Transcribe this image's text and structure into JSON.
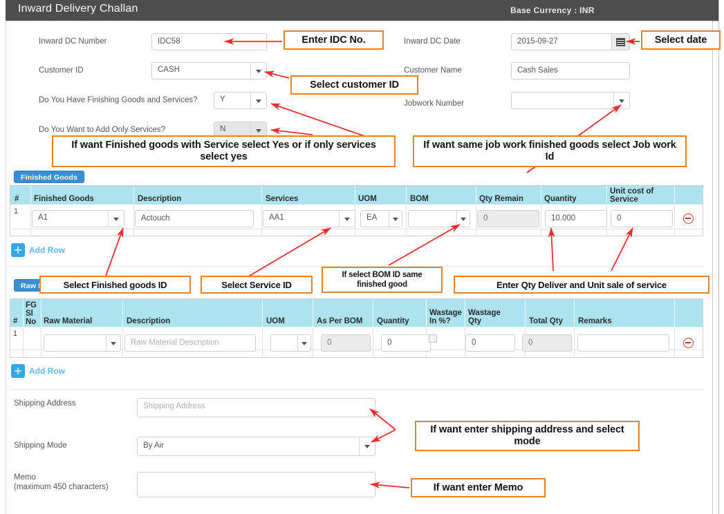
{
  "window": {
    "title": "Inward Delivery Challan",
    "base_currency": "Base Currency : INR"
  },
  "form": {
    "inward_dc_number": {
      "label": "Inward DC Number",
      "value": "IDC58"
    },
    "inward_dc_date": {
      "label": "Inward DC Date",
      "value": "2015-09-27",
      "icon": "calendar-icon"
    },
    "customer_id": {
      "label": "Customer ID",
      "value": "CASH"
    },
    "customer_name": {
      "label": "Customer Name",
      "value": "Cash Sales"
    },
    "has_finishing_goods_and_services": {
      "label": "Do You Have Finishing Goods and Services?",
      "value": "Y"
    },
    "jobwork_number": {
      "label": "Jobwork Number",
      "value": ""
    },
    "add_only_services": {
      "label": "Do You Want to Add Only Services?",
      "value": "N"
    },
    "shipping_address": {
      "label": "Shipping Address",
      "value": "",
      "placeholder": "Shipping Address"
    },
    "shipping_mode": {
      "label": "Shipping Mode",
      "value": "By Air"
    },
    "memo": {
      "label": "Memo",
      "sublabel": "(maximum 450 characters)",
      "value": ""
    }
  },
  "finished_goods": {
    "tab_label": "Finished Goods",
    "columns": [
      "#",
      "Finished Goods",
      "Description",
      "Services",
      "UOM",
      "BOM",
      "Qty Remain",
      "Quantity",
      "Unit cost of\nService",
      ""
    ],
    "rows": [
      {
        "num": "1",
        "finished_goods": "A1",
        "description": "Actouch",
        "services": "AA1",
        "uom": "EA",
        "bom": "",
        "qty_remain": "0",
        "quantity": "10.000",
        "unit_cost_of_service": "0"
      }
    ],
    "add_row_label": "Add Row",
    "remove_icon": "minus-circle-icon"
  },
  "raw_material": {
    "tab_label": "Raw Material",
    "columns": [
      "#",
      "FG\nSl\nNo",
      "Raw Material",
      "Description",
      "UOM",
      "As Per BOM",
      "Quantity",
      "Wastage\nIn %?",
      "Wastage\nQty",
      "Total Qty",
      "Remarks",
      ""
    ],
    "rows": [
      {
        "num": "1",
        "fg_sl_no": "",
        "raw_material": "",
        "description_placeholder": "Raw Material Description",
        "uom": "",
        "as_per_bom": "0",
        "quantity": "0",
        "wastage_in_pct": false,
        "wastage_qty": "0",
        "total_qty": "0",
        "remarks": ""
      }
    ],
    "add_row_label": "Add Row",
    "remove_icon": "minus-circle-icon"
  },
  "annotations": [
    {
      "id": "enter-idc-no",
      "text": "Enter IDC No."
    },
    {
      "id": "select-date",
      "text": "Select date"
    },
    {
      "id": "select-customer-id",
      "text": "Select customer ID"
    },
    {
      "id": "finished-goods-service-hint",
      "text": "If want Finished goods with Service select Yes or if only services select yes"
    },
    {
      "id": "jobwork-hint",
      "text": "If want same job work finished goods select Job work Id"
    },
    {
      "id": "select-finished-goods-id",
      "text": "Select Finished goods ID"
    },
    {
      "id": "select-service-id",
      "text": "Select Service ID"
    },
    {
      "id": "select-bom-id",
      "text": "If select BOM ID same finished good"
    },
    {
      "id": "enter-qty-unit-sale",
      "text": "Enter Qty Deliver and Unit sale of service"
    },
    {
      "id": "shipping-hint",
      "text": "If want enter shipping address and select mode"
    },
    {
      "id": "memo-hint",
      "text": "If want enter Memo"
    }
  ],
  "colors": {
    "titlebar": "#4d4d4d",
    "tab_blue": "#3a8fd4",
    "grid_header": "#ace3ef",
    "callout_border": "#e8821e",
    "arrow": "#ef2b2b",
    "add_row_blue": "#35a7e8"
  }
}
